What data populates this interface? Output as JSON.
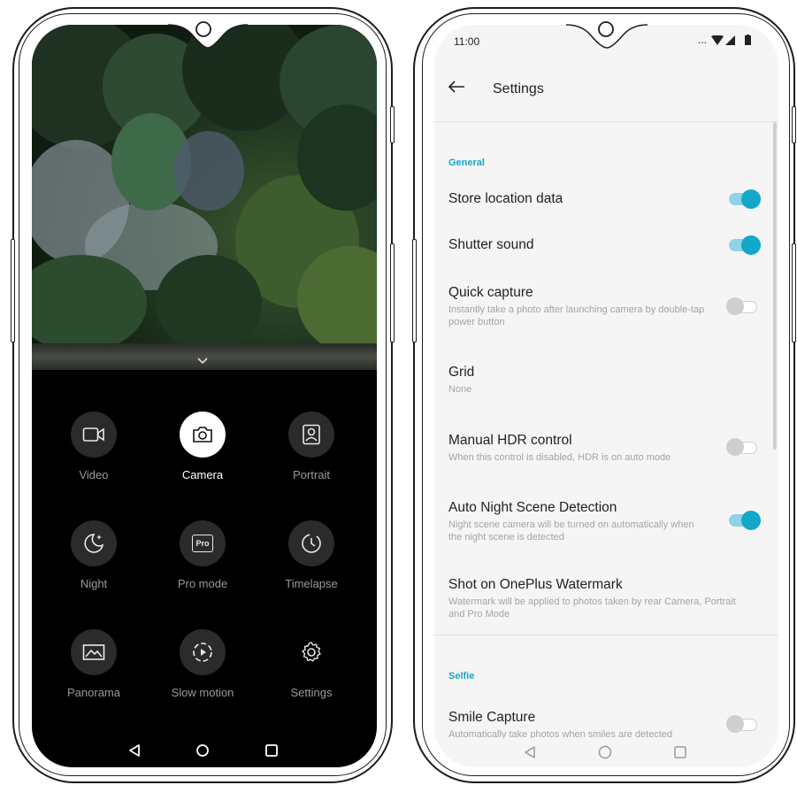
{
  "left_screen": {
    "modes": [
      {
        "label": "Video",
        "icon": "video-icon",
        "active": false
      },
      {
        "label": "Camera",
        "icon": "camera-icon",
        "active": true
      },
      {
        "label": "Portrait",
        "icon": "portrait-icon",
        "active": false
      },
      {
        "label": "Night",
        "icon": "night-icon",
        "active": false
      },
      {
        "label": "Pro mode",
        "icon": "pro-mode-icon",
        "active": false
      },
      {
        "label": "Timelapse",
        "icon": "timelapse-icon",
        "active": false
      },
      {
        "label": "Panorama",
        "icon": "panorama-icon",
        "active": false
      },
      {
        "label": "Slow motion",
        "icon": "slow-motion-icon",
        "active": false
      },
      {
        "label": "Settings",
        "icon": "settings-icon",
        "active": false
      }
    ],
    "pro_badge": "Pro",
    "nav": [
      "back-icon",
      "home-icon",
      "recents-icon"
    ]
  },
  "right_screen": {
    "status": {
      "time": "11:00",
      "ellipsis": "..."
    },
    "header": {
      "title": "Settings"
    },
    "general_label": "General",
    "settings": [
      {
        "title": "Store location data",
        "subtitle": "",
        "toggle": true
      },
      {
        "title": "Shutter sound",
        "subtitle": "",
        "toggle": true
      },
      {
        "title": "Quick capture",
        "subtitle": "Instantly take a photo after launching camera by double-tap power button",
        "toggle": false
      },
      {
        "title": "Grid",
        "subtitle": "None",
        "toggle": null
      },
      {
        "title": "Manual HDR control",
        "subtitle": "When this control is disabled, HDR is on auto mode",
        "toggle": false
      },
      {
        "title": "Auto Night Scene Detection",
        "subtitle": "Night scene camera will be turned on automatically when the night scene is detected",
        "toggle": true
      },
      {
        "title": "Shot on OnePlus Watermark",
        "subtitle": "Watermark will be applied to photos taken by rear Camera, Portrait and Pro Mode",
        "toggle": null
      }
    ],
    "selfie_label": "Selfie",
    "selfie_settings": [
      {
        "title": "Smile Capture",
        "subtitle": "Automatically take photos when smiles are detected",
        "toggle": false
      }
    ],
    "colors": {
      "accent": "#13a8c9",
      "background": "#f5f5f5"
    }
  }
}
